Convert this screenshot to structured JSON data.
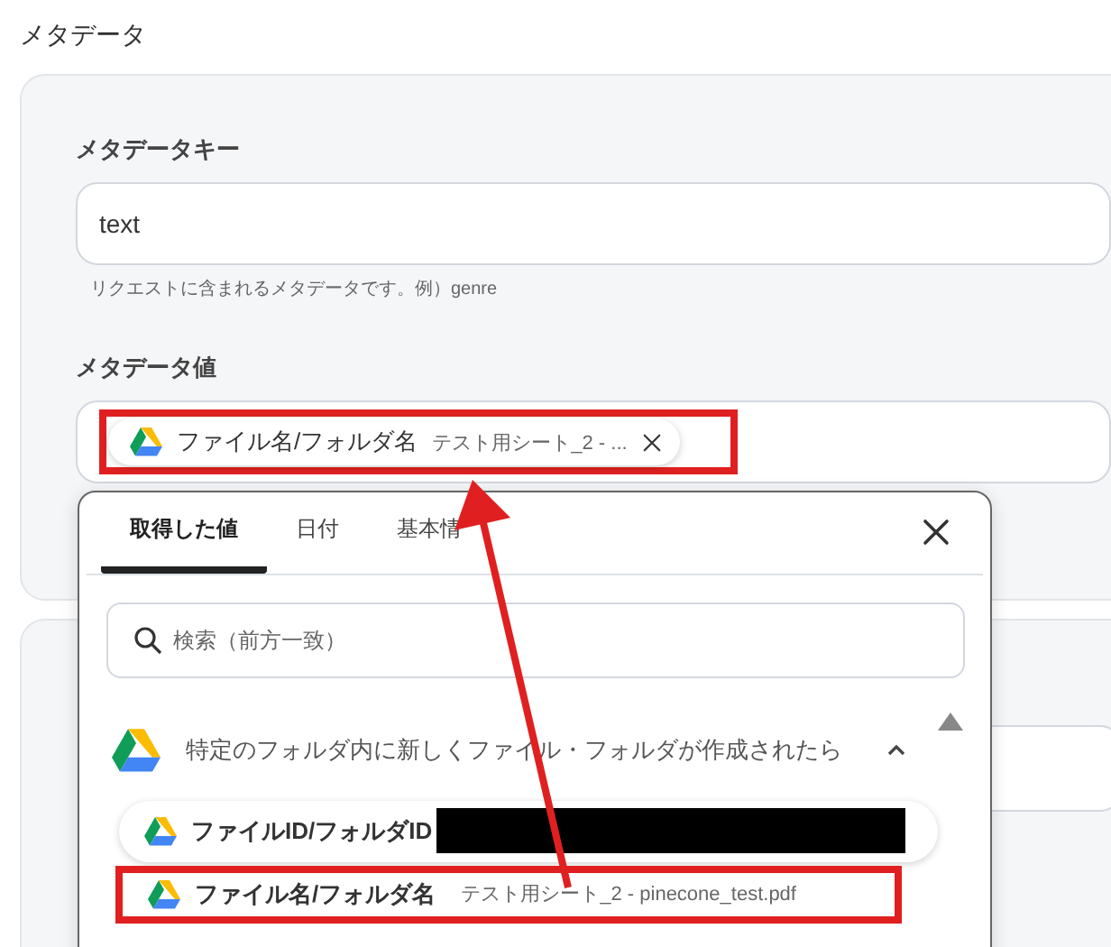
{
  "section_title": "メタデータ",
  "key_field": {
    "label": "メタデータキー",
    "value": "text",
    "help": "リクエストに含まれるメタデータです。例）genre"
  },
  "value_field": {
    "label": "メタデータ値",
    "chip": {
      "name": "ファイル名/フォルダ名",
      "value": "テスト用シート_2 - ...",
      "highlighted": true
    }
  },
  "popup": {
    "tabs": [
      {
        "label": "取得した値",
        "selected": true
      },
      {
        "label": "日付",
        "selected": false
      },
      {
        "label": "基本情",
        "selected": false
      }
    ],
    "search": {
      "placeholder": "検索（前方一致）"
    },
    "group": {
      "title": "特定のフォルダ内に新しくファイル・フォルダが作成されたら",
      "expanded": true,
      "items": [
        {
          "name": "ファイルID/フォルダID",
          "redacted": true,
          "highlighted": false
        },
        {
          "name": "ファイル名/フォルダ名",
          "value": "テスト用シート_2 - pinecone_test.pdf",
          "redacted": false,
          "highlighted": true
        }
      ]
    }
  }
}
